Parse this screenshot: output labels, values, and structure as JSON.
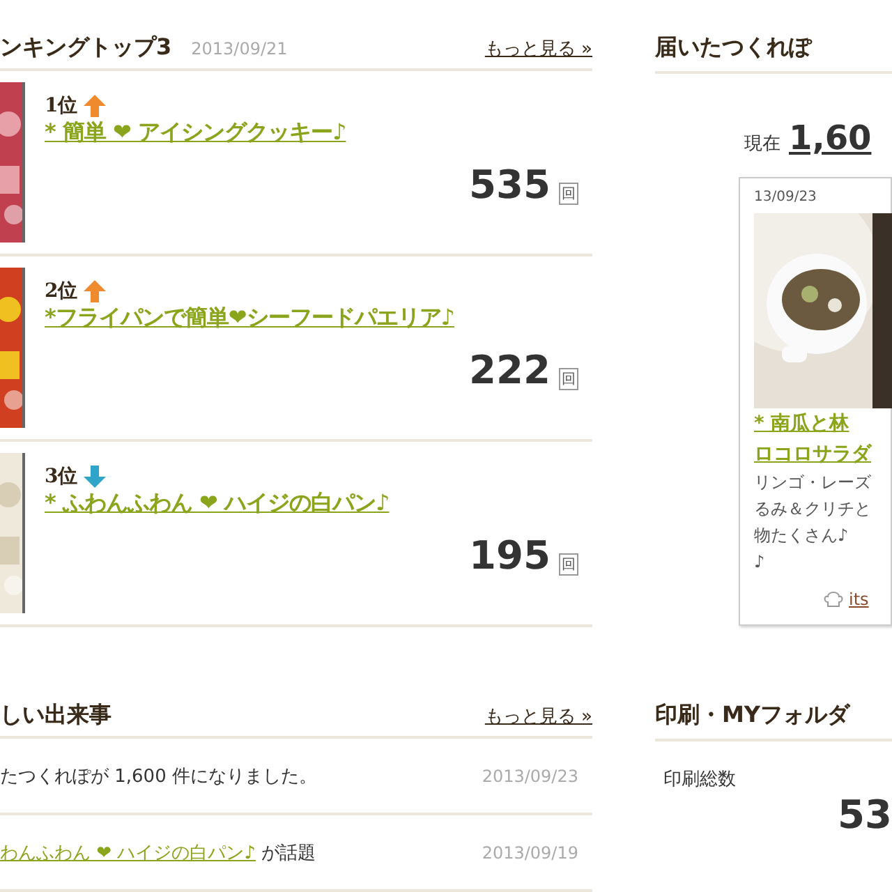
{
  "ranking": {
    "title": "ンキングトップ3",
    "date": "2013/09/21",
    "more_link": "もっと見る »",
    "items": [
      {
        "rank": "1位",
        "kind": "up",
        "title": "* 簡単 ❤ アイシングクッキー♪",
        "count": "535",
        "unit": "回"
      },
      {
        "rank": "2位",
        "kind": "up",
        "title": "*フライパンで簡単❤シーフードパエリア♪",
        "count": "222",
        "unit": "回"
      },
      {
        "rank": "3位",
        "kind": "down",
        "title": "* ふわんふわん ❤ ハイジの白パン♪",
        "count": "195",
        "unit": "回"
      }
    ]
  },
  "tsukurepo": {
    "title": "届いたつくれぽ",
    "current_label": "現在",
    "current_count": "1,60",
    "card": {
      "date": "13/09/23",
      "title_lines": [
        "* 南瓜と林",
        "ロコロサラダ"
      ],
      "description_lines": [
        "リンゴ・レーズ",
        "るみ＆クリチと",
        "物たくさん♪",
        "♪"
      ],
      "author": "its"
    }
  },
  "news": {
    "title": "しい出来事",
    "more_link": "もっと見る »",
    "items": [
      {
        "kind": "text",
        "text": "たつくれぽが 1,600 件になりました。",
        "date": "2013/09/23"
      },
      {
        "kind": "link",
        "link": "わんふわん ❤ ハイジの白パン♪",
        "text": " が話題",
        "date": "2013/09/19"
      }
    ]
  },
  "print": {
    "title": "印刷・MYフォルダ",
    "label": "印刷総数",
    "count": "53"
  }
}
